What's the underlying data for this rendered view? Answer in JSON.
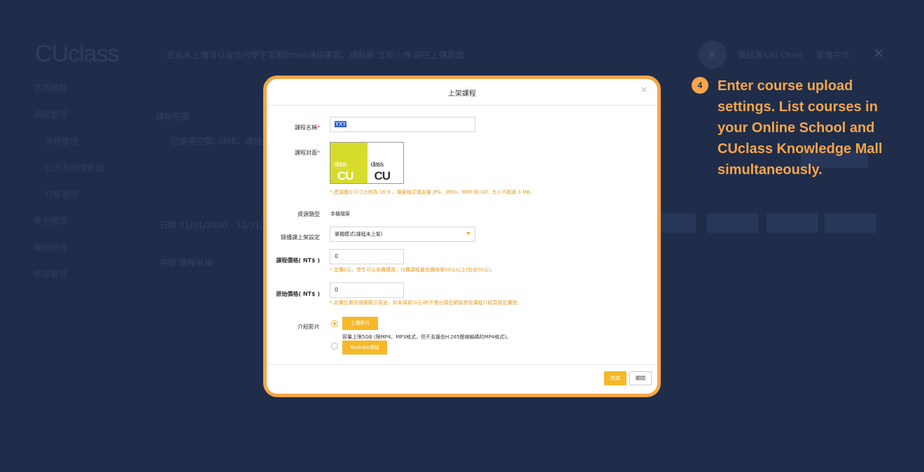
{
  "background": {
    "logo": "CUclass",
    "notice": "您尚未上傳可以收信的學生電郵Email通知書寫，請點擊 立即上傳 前往上傳頁面",
    "avatar_letter": "K",
    "user_name": "黃鈺菁Kiki Chen",
    "language": "繁體中文",
    "sidebar": [
      "首頁概覽",
      "網校管理",
      "課程管理",
      "公告及新聞管理",
      "訂單管理",
      "學生管理",
      "權限管理",
      "帳號管理"
    ],
    "storage_label": "儲存空間",
    "storage_text": "已使用空間: 0MB，總儲存",
    "date_range": "日期    01/01/2020 - 12/31/2020",
    "table_head": "序號      課程名稱"
  },
  "modal": {
    "title": "上架課程",
    "close_icon": "×",
    "course_name_label": "課程名稱",
    "course_name_value": "YXY",
    "cover_label": "課程封面",
    "cover_logo_text": "CU",
    "cover_logo_small": "class",
    "cover_hint": "* 建議圖片尺寸比例為 16:9 ，檔案格式僅支援 JPG、JPEG、BMP 和 GIF, 大小不超過 3 MB。",
    "resource_type_label": "資源類型",
    "resource_type_value": "本機檔案",
    "listing_label": "錄播課上架設定",
    "listing_value": "單獨模式(課程未上架)",
    "price_label": "課程價格( NT$ )",
    "price_value": "0",
    "price_hint": "* 定價0元，學生可以免費購買；付費課程最低價格需50元以上(包含50元)。",
    "original_price_label": "原始價格( NT$ )",
    "original_price_value": "0",
    "original_price_hint": "* 此欄位資訊僅做顯示用途，如未填寫(0元)則不會出現在網路學校課程介紹頁買定價旁。",
    "intro_video_label": "介紹影片",
    "upload_video_button": "上傳影片",
    "upload_hint": "容量上限5GB (限MP4、MP3格式，但不支援由H.265壓縮編碼的MP4格式)。",
    "youtube_button": "Youtube連結",
    "done_button": "完成",
    "close_button": "關閉"
  },
  "callout": {
    "step_number": "4",
    "text": "Enter course upload settings. List courses in your Online School and CUclass Knowledge Mall simultaneously."
  }
}
